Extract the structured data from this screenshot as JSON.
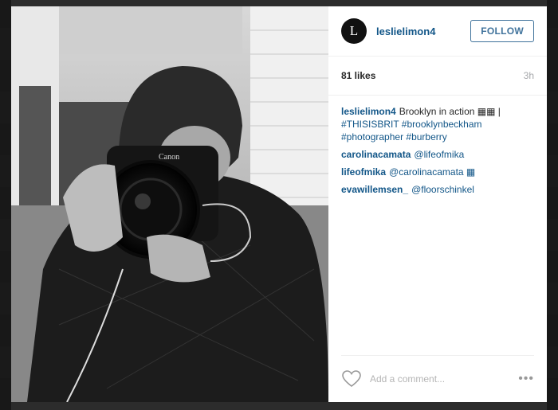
{
  "post": {
    "username": "leslielimon4",
    "avatar_letter": "L",
    "follow_label": "FOLLOW",
    "likes": "81 likes",
    "time": "3h"
  },
  "comments": [
    {
      "user": "leslielimon4",
      "text": "Brooklyn in action ▦▦ |",
      "tags": "#THISISBRIT #brooklynbeckham #photographer #burberry"
    },
    {
      "user": "carolinacamata",
      "text": "@lifeofmika"
    },
    {
      "user": "lifeofmika",
      "text": "@carolinacamata ▦"
    },
    {
      "user": "evawillemsen_",
      "text": "@floorschinkel"
    }
  ],
  "footer": {
    "comment_placeholder": "Add a comment...",
    "more_label": "•••"
  },
  "icons": {
    "heart": "heart-icon",
    "more": "more-options-icon"
  },
  "colors": {
    "username": "#125688",
    "follow": "#3f729b"
  }
}
